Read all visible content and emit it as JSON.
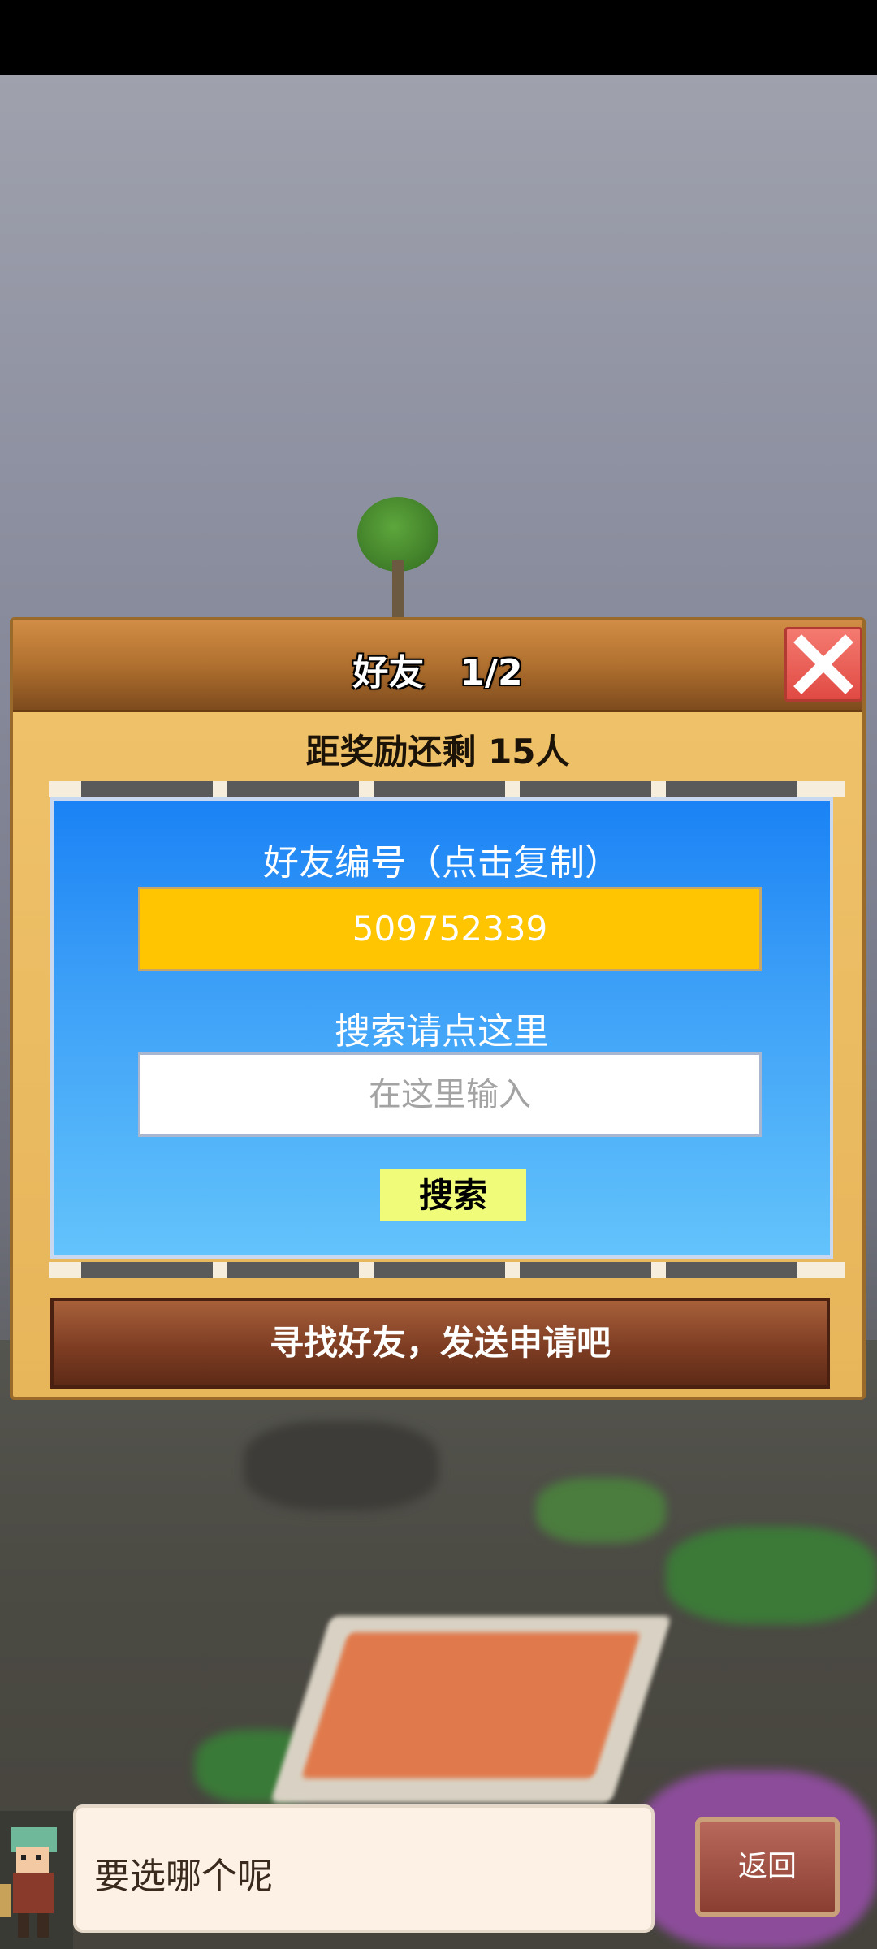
{
  "dialog": {
    "title": "好友　1/2",
    "reward_text": "距奖励还剩 15人",
    "friend_id_label": "好友编号（点击复制）",
    "friend_id_value": "509752339",
    "search_label": "搜索请点这里",
    "search_placeholder": "在这里输入",
    "search_button": "搜索",
    "find_friends_button": "寻找好友，发送申请吧"
  },
  "bottom_bar": {
    "speech_text": "要选哪个呢",
    "back_button": "返回"
  },
  "colors": {
    "panel_blue": "#1a82f5",
    "id_box_yellow": "#fec500",
    "search_button": "#f0fb7a",
    "close_button": "#e04a43",
    "frame_gold": "#f0c36b"
  },
  "icons": [
    "close-icon",
    "arrow-left-icon",
    "arrow-right-icon",
    "character-avatar"
  ]
}
